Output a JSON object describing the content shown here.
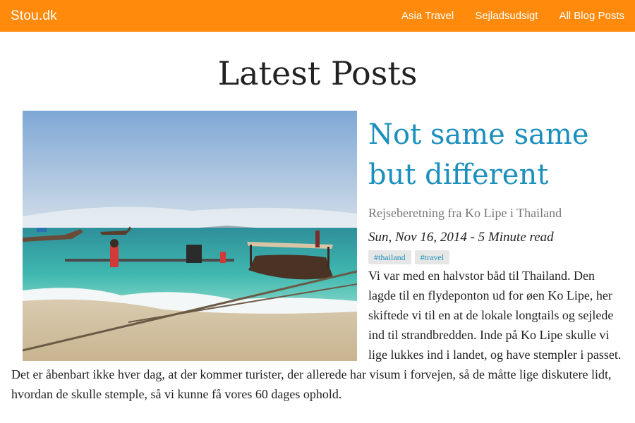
{
  "navbar": {
    "brand": "Stou.dk",
    "links": [
      "Asia Travel",
      "Sejladsudsigt",
      "All Blog Posts"
    ]
  },
  "page": {
    "title": "Latest Posts"
  },
  "post": {
    "title": "Not same same but different",
    "subtitle": "Rejseberetning fra Ko Lipe i Thailand",
    "meta": "Sun, Nov 16, 2014 - 5 Minute read",
    "tags": [
      "#thailand",
      "#travel"
    ],
    "excerpt": "Vi var med en halvstor båd til Thailand. Den lagde til en flydeponton ud for øen Ko Lipe, her skiftede vi til en at de lokale longtails og sejlede ind til strandbredden. Inde på Ko Lipe skulle vi lige lukkes ind i landet, og have stempler i passet. Det er åbenbart ikke hver dag, at der kommer turister, der allerede har visum i forvejen, så de måtte lige diskutere lidt, hvordan de skulle stemple, så vi kunne få vores 60 dages ophold."
  },
  "colors": {
    "navbar": "#ff8a0c",
    "link": "#1b8fbd",
    "tag_bg": "#e6e6e6",
    "text": "#222222",
    "muted": "#777777"
  }
}
